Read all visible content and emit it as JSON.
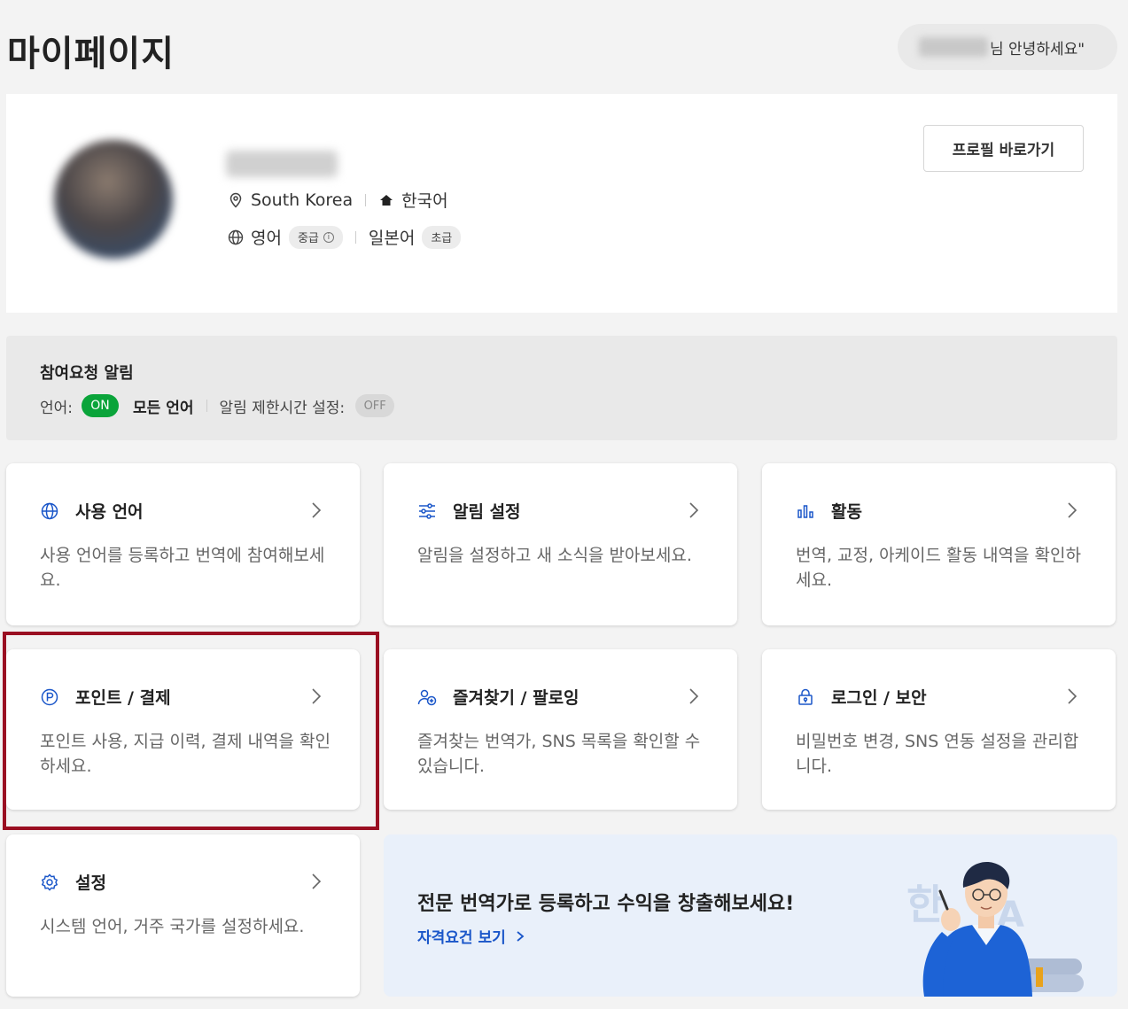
{
  "header": {
    "title": "마이페이지",
    "greeting_suffix": "님 안녕하세요\""
  },
  "profile": {
    "location": "South Korea",
    "native_language": "한국어",
    "languages": [
      {
        "name": "영어",
        "level": "중급"
      },
      {
        "name": "일본어",
        "level": "초급"
      }
    ],
    "profile_button": "프로필 바로가기"
  },
  "notification": {
    "title": "참여요청 알림",
    "language_label": "언어:",
    "language_toggle": "ON",
    "language_value": "모든 언어",
    "time_limit_label": "알림 제한시간 설정:",
    "time_limit_toggle": "OFF"
  },
  "cards": [
    {
      "title": "사용 언어",
      "desc": "사용 언어를 등록하고 번역에 참여해보세요.",
      "icon": "globe-icon"
    },
    {
      "title": "알림 설정",
      "desc": "알림을 설정하고 새 소식을 받아보세요.",
      "icon": "sliders-icon"
    },
    {
      "title": "활동",
      "desc": "번역, 교정, 아케이드 활동 내역을 확인하세요.",
      "icon": "bar-chart-icon"
    },
    {
      "title": "포인트 / 결제",
      "desc": "포인트 사용, 지급 이력, 결제 내역을 확인하세요.",
      "icon": "point-icon"
    },
    {
      "title": "즐겨찾기 / 팔로잉",
      "desc": "즐겨찾는 번역가, SNS 목록을 확인할 수 있습니다.",
      "icon": "user-plus-icon"
    },
    {
      "title": "로그인 / 보안",
      "desc": "비밀번호 변경, SNS 연동 설정을 관리합니다.",
      "icon": "lock-icon"
    },
    {
      "title": "설정",
      "desc": "시스템 언어, 거주 국가를 설정하세요.",
      "icon": "gear-icon"
    }
  ],
  "promo": {
    "title": "전문 번역가로 등록하고 수익을 창출해보세요!",
    "link": "자격요건 보기",
    "art_letters": [
      "한",
      "A"
    ]
  },
  "colors": {
    "accent_blue": "#1a56c9",
    "toggle_on": "#0aa43a",
    "highlight": "#9a0f22"
  }
}
